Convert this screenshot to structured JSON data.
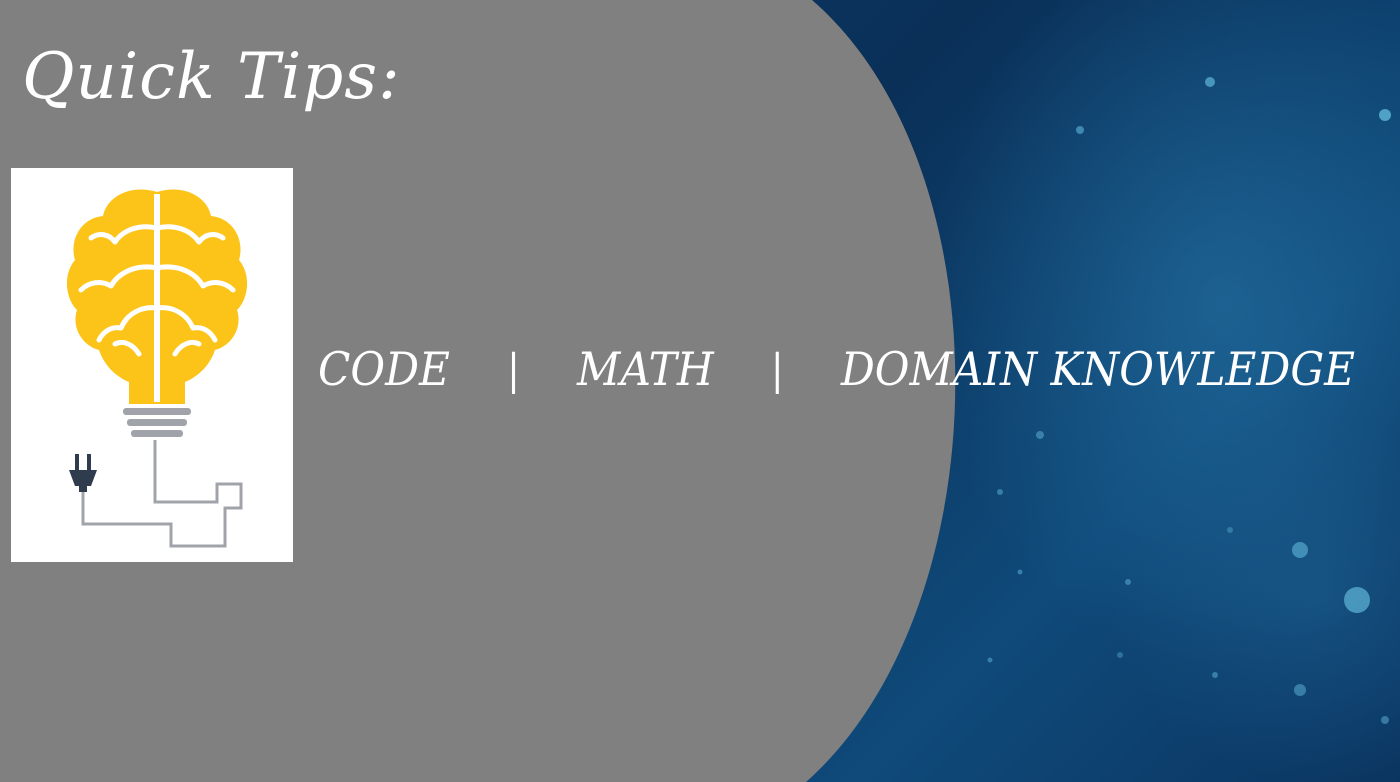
{
  "slide": {
    "title": "Quick Tips:",
    "topics": [
      "CODE",
      "MATH",
      "DOMAIN KNOWLEDGE"
    ],
    "separator": "|",
    "illustration": "brain-lightbulb-plug-icon"
  },
  "colors": {
    "panel_gray": "#808080",
    "background_blue": "#0b3561",
    "brain_yellow": "#fcc419",
    "text": "#ffffff"
  }
}
